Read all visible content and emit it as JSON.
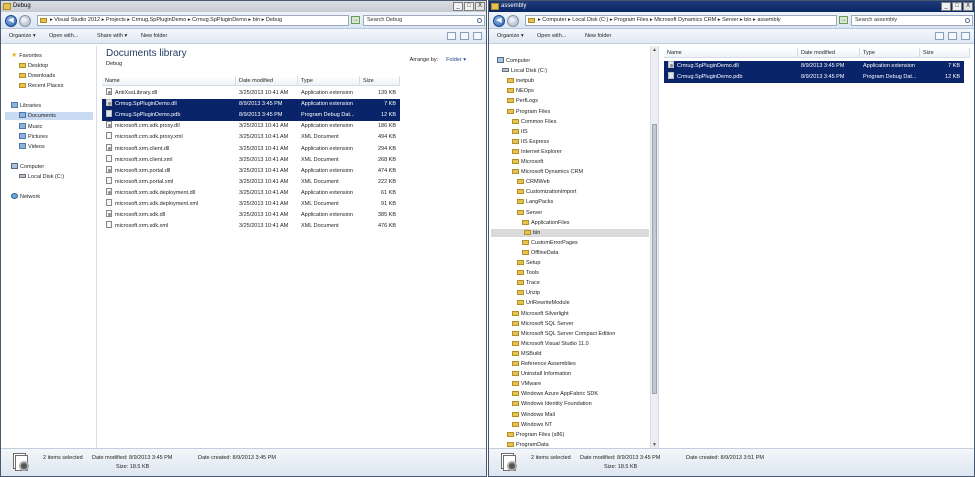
{
  "left_window": {
    "title": "Debug",
    "window_buttons": [
      "_",
      "□",
      "X"
    ],
    "breadcrumb": [
      "Visual Studio 2012",
      "Projects",
      "Crmug.SpPluginDemo",
      "Crmug.SpPluginDemo",
      "bin",
      "Debug"
    ],
    "search_placeholder": "Search Debug",
    "toolbar": {
      "organize": "Organize ▾",
      "open_with": "Open with...",
      "share_with": "Share with ▾",
      "new_folder": "New folder"
    },
    "nav": {
      "favorites": "Favorites",
      "desktop": "Desktop",
      "downloads": "Downloads",
      "recent_places": "Recent Places",
      "libraries": "Libraries",
      "documents": "Documents",
      "music": "Music",
      "pictures": "Pictures",
      "videos": "Videos",
      "computer": "Computer",
      "local_disk": "Local Disk (C:)",
      "network": "Network"
    },
    "library_title": "Documents library",
    "library_subtitle": "Debug",
    "arrange_label": "Arrange by:",
    "arrange_value": "Folder ▾",
    "columns": {
      "name": "Name",
      "date": "Date modified",
      "type": "Type",
      "size": "Size"
    },
    "files": [
      {
        "name": "AntiXssLibrary.dll",
        "date": "3/25/2013 10:41 AM",
        "type": "Application extension",
        "size": "139 KB",
        "selected": false
      },
      {
        "name": "Crmug.SpPluginDemo.dll",
        "date": "8/9/2013 3:45 PM",
        "type": "Application extension",
        "size": "7 KB",
        "selected": true
      },
      {
        "name": "Crmug.SpPluginDemo.pdb",
        "date": "8/9/2013 3:45 PM",
        "type": "Program Debug Dat...",
        "size": "12 KB",
        "selected": true
      },
      {
        "name": "microsoft.crm.sdk.proxy.dll",
        "date": "3/25/2013 10:41 AM",
        "type": "Application extension",
        "size": "186 KB",
        "selected": false
      },
      {
        "name": "microsoft.crm.sdk.proxy.xml",
        "date": "3/25/2013 10:41 AM",
        "type": "XML Document",
        "size": "494 KB",
        "selected": false
      },
      {
        "name": "microsoft.xrm.client.dll",
        "date": "3/25/2013 10:41 AM",
        "type": "Application extension",
        "size": "294 KB",
        "selected": false
      },
      {
        "name": "microsoft.xrm.client.xml",
        "date": "3/25/2013 10:41 AM",
        "type": "XML Document",
        "size": "268 KB",
        "selected": false
      },
      {
        "name": "microsoft.xrm.portal.dll",
        "date": "3/25/2013 10:41 AM",
        "type": "Application extension",
        "size": "474 KB",
        "selected": false
      },
      {
        "name": "microsoft.xrm.portal.xml",
        "date": "3/25/2013 10:41 AM",
        "type": "XML Document",
        "size": "222 KB",
        "selected": false
      },
      {
        "name": "microsoft.xrm.sdk.deployment.dll",
        "date": "3/25/2013 10:41 AM",
        "type": "Application extension",
        "size": "61 KB",
        "selected": false
      },
      {
        "name": "microsoft.xrm.sdk.deployment.xml",
        "date": "3/25/2013 10:41 AM",
        "type": "XML Document",
        "size": "91 KB",
        "selected": false
      },
      {
        "name": "microsoft.xrm.sdk.dll",
        "date": "3/25/2013 10:41 AM",
        "type": "Application extension",
        "size": "385 KB",
        "selected": false
      },
      {
        "name": "microsoft.xrm.sdk.xml",
        "date": "3/25/2013 10:41 AM",
        "type": "XML Document",
        "size": "476 KB",
        "selected": false
      }
    ],
    "details": {
      "selected": "2 items selected",
      "date_modified": "Date modified: 8/9/2013 3:45 PM",
      "date_created": "Date created: 8/9/2013 3:45 PM",
      "size": "Size: 18.5 KB"
    }
  },
  "right_window": {
    "title": "assembly",
    "window_buttons": [
      "_",
      "□",
      "X"
    ],
    "breadcrumb": [
      "Computer",
      "Local Disk (C:)",
      "Program Files",
      "Microsoft Dynamics CRM",
      "Server",
      "bin",
      "assembly"
    ],
    "search_placeholder": "Search assembly",
    "toolbar": {
      "organize": "Organize ▾",
      "open_with": "Open with...",
      "new_folder": "New folder"
    },
    "tree": [
      {
        "label": "Computer",
        "level": 0,
        "icon": "computer-icon"
      },
      {
        "label": "Local Disk (C:)",
        "level": 1,
        "icon": "disk-icon"
      },
      {
        "label": "inetpub",
        "level": 2
      },
      {
        "label": "NEOps",
        "level": 2
      },
      {
        "label": "PerfLogs",
        "level": 2
      },
      {
        "label": "Program Files",
        "level": 2
      },
      {
        "label": "Common Files",
        "level": 3
      },
      {
        "label": "IIS",
        "level": 3
      },
      {
        "label": "IIS Express",
        "level": 3
      },
      {
        "label": "Internet Explorer",
        "level": 3
      },
      {
        "label": "Microsoft",
        "level": 3
      },
      {
        "label": "Microsoft Dynamics CRM",
        "level": 3
      },
      {
        "label": "CRMWeb",
        "level": 4
      },
      {
        "label": "CustomizationImport",
        "level": 4
      },
      {
        "label": "LangPacks",
        "level": 4
      },
      {
        "label": "Server",
        "level": 4
      },
      {
        "label": "ApplicationFiles",
        "level": 5
      },
      {
        "label": "bin",
        "level": 5,
        "selected": true
      },
      {
        "label": "CustomErrorPages",
        "level": 5
      },
      {
        "label": "OfflineData",
        "level": 5
      },
      {
        "label": "Setup",
        "level": 4
      },
      {
        "label": "Tools",
        "level": 4
      },
      {
        "label": "Trace",
        "level": 4
      },
      {
        "label": "Unzip",
        "level": 4
      },
      {
        "label": "UrlRewriteModule",
        "level": 4
      },
      {
        "label": "Microsoft Silverlight",
        "level": 3
      },
      {
        "label": "Microsoft SQL Server",
        "level": 3
      },
      {
        "label": "Microsoft SQL Server Compact Edition",
        "level": 3
      },
      {
        "label": "Microsoft Visual Studio 11.0",
        "level": 3
      },
      {
        "label": "MSBuild",
        "level": 3
      },
      {
        "label": "Reference Assemblies",
        "level": 3
      },
      {
        "label": "Uninstall Information",
        "level": 3
      },
      {
        "label": "VMware",
        "level": 3
      },
      {
        "label": "Windows Azure AppFabric SDK",
        "level": 3
      },
      {
        "label": "Windows Identity Foundation",
        "level": 3
      },
      {
        "label": "Windows Mail",
        "level": 3
      },
      {
        "label": "Windows NT",
        "level": 3
      },
      {
        "label": "Program Files (x86)",
        "level": 2
      },
      {
        "label": "ProgramData",
        "level": 2
      }
    ],
    "columns": {
      "name": "Name",
      "date": "Date modified",
      "type": "Type",
      "size": "Size"
    },
    "files": [
      {
        "name": "Crmug.SpPluginDemo.dll",
        "date": "8/9/2013 3:45 PM",
        "type": "Application extension",
        "size": "7 KB",
        "selected": true
      },
      {
        "name": "Crmug.SpPluginDemo.pdb",
        "date": "8/9/2013 3:45 PM",
        "type": "Program Debug Dat...",
        "size": "12 KB",
        "selected": true
      }
    ],
    "details": {
      "selected": "2 items selected",
      "date_modified": "Date modified: 8/9/2013 3:45 PM",
      "date_created": "Date created: 8/9/2013 3:51 PM",
      "size": "Size: 18.5 KB"
    }
  }
}
